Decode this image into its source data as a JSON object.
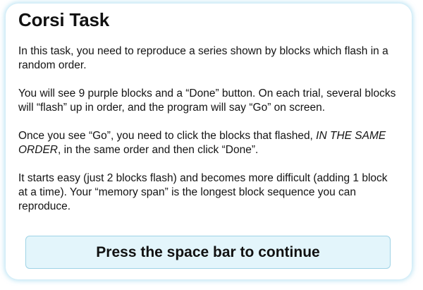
{
  "title": "Corsi Task",
  "paragraphs": {
    "p1": "In this task, you need to reproduce a series shown by blocks which flash in a random order.",
    "p2": "You will see 9 purple blocks and a “Done” button. On each trial, several blocks will “flash” up in order, and the program will say “Go” on screen.",
    "p3_before": "Once you see “Go”, you need to click the blocks that flashed, ",
    "p3_emphasis": "IN THE SAME ORDER",
    "p3_after": ", in the same order and then click “Done”.",
    "p4": "It starts easy (just 2 blocks flash) and becomes more difficult (adding 1 block at a time). Your “memory span” is the longest block sequence you can reproduce."
  },
  "continue_prompt": "Press the space bar to continue"
}
